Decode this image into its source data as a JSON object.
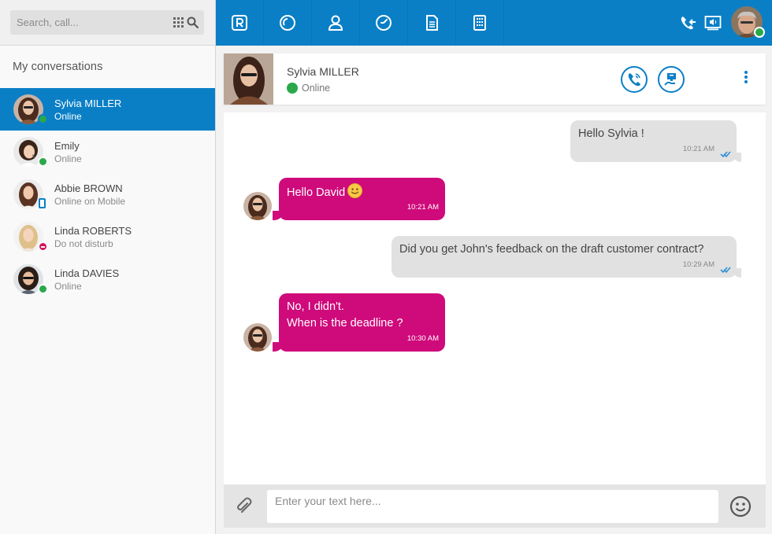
{
  "search": {
    "placeholder": "Search, call..."
  },
  "sidebar": {
    "title": "My conversations",
    "items": [
      {
        "name": "Sylvia MILLER",
        "status": "Online",
        "presence": "online"
      },
      {
        "name": "Emily",
        "status": "Online",
        "presence": "online"
      },
      {
        "name": "Abbie BROWN",
        "status": "Online on Mobile",
        "presence": "mobile"
      },
      {
        "name": "Linda ROBERTS",
        "status": "Do not disturb",
        "presence": "dnd"
      },
      {
        "name": "Linda DAVIES",
        "status": "Online",
        "presence": "online"
      }
    ]
  },
  "topbar": {
    "nav_icons": [
      "rainbow-logo-icon",
      "recent-calls-icon",
      "contacts-icon",
      "clock-icon",
      "document-icon",
      "company-directory-icon"
    ],
    "right_icons": [
      "call-forward-icon",
      "audio-device-icon"
    ],
    "accent_color": "#0a7fc6"
  },
  "conversation": {
    "contact_name": "Sylvia MILLER",
    "contact_status": "Online",
    "actions": [
      "call-icon",
      "share-screen-icon",
      "more-options-icon"
    ]
  },
  "messages": [
    {
      "direction": "out",
      "text": "Hello Sylvia !",
      "time": "10:21 AM",
      "read": true
    },
    {
      "direction": "in",
      "text": "Hello David",
      "emoji": "smiley",
      "time": "10:21 AM"
    },
    {
      "direction": "out",
      "text": "Did you get John's feedback on the draft customer contract?",
      "time": "10:29 AM",
      "read": true
    },
    {
      "direction": "in",
      "lines": [
        "No, I didn't.",
        "When is the deadline ?"
      ],
      "time": "10:30 AM"
    }
  ],
  "composer": {
    "placeholder": "Enter your text here..."
  },
  "colors": {
    "incoming_bubble": "#cf0a7b",
    "outgoing_bubble": "#e1e1e1",
    "online": "#2aa84a",
    "dnd": "#d4145a"
  }
}
